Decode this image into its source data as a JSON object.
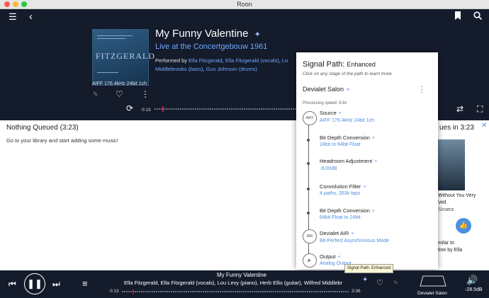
{
  "window": {
    "title": "Roon"
  },
  "album": {
    "title": "My Funny Valentine",
    "subtitle": "Live at the Concertgebouw 1961",
    "performed_prefix": "Performed by",
    "performers": [
      "Ella Fitzgerald",
      "Ella Fitzgerald (vocals)",
      "Lo",
      "Middlebrooks (bass)",
      "Gus Johnson (drums)"
    ],
    "format": "AIFF 176.4kHz 24bit 1ch",
    "cover_text": "FITZGERALD",
    "elapsed": "0:13"
  },
  "queue": {
    "title": "Nothing Queued (3:23)",
    "empty_message": "Go to your library and start adding some music!",
    "right_title": "ues in 3:23",
    "rec_title_1": "Without You Very",
    "rec_title_2": "Vell",
    "rec_artist": "Sinatra",
    "similar_1": "milar to",
    "similar_2": "tine by Ella"
  },
  "signal_path": {
    "title": "Signal Path:",
    "quality": "Enhanced",
    "hint": "Click on any stage of the path to learn more",
    "zone": "Devialet Salon",
    "processing_speed": "Processing speed: 9.8x",
    "stages": [
      {
        "name": "Source",
        "detail": "AIFF 176.4kHz 24bit 1ch",
        "badge": "AIFF"
      },
      {
        "name": "Bit Depth Conversion",
        "detail": "24bit to 64bit Float"
      },
      {
        "name": "Headroom Adjustment",
        "detail": "-9.00dB"
      },
      {
        "name": "Convolution Filter",
        "detail": "4 paths, 263k taps"
      },
      {
        "name": "Bit Depth Conversion",
        "detail": "64bit Float to 24bit"
      },
      {
        "name": "Devialet AIR",
        "detail": "Bit-Perfect Asynchronous Mode",
        "badge": "AIR"
      },
      {
        "name": "Output",
        "detail": "Analog Output"
      }
    ]
  },
  "player": {
    "track": "My Funny Valentine",
    "artists": "Ella Fitzgerald, Ella Fitzgerald (vocals), Lou Levy (piano), Herb Ellis (guitar), Wilfred Middlebr",
    "elapsed": "0:13",
    "duration": "3:36",
    "zone": "Devialet Salon",
    "volume": "-28.5dB",
    "tooltip": "Signal Path: Enhanced"
  },
  "colors": {
    "accent": "#4a90e2",
    "background_dark": "#141b2b",
    "link": "#6fa8ff",
    "progress": "#e0245e"
  }
}
